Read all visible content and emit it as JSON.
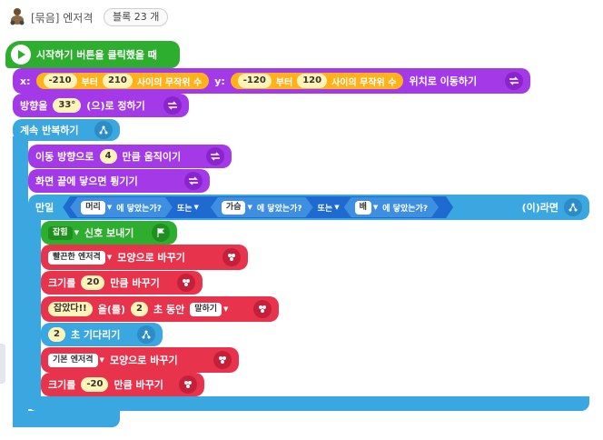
{
  "header": {
    "title": "[묶음] 엔저격",
    "count_label": "블록 23 개"
  },
  "blocks": {
    "start": {
      "label": "시작하기 버튼을 클릭했을 때"
    },
    "move": {
      "x_label": "x:",
      "x_from": "-210",
      "from_word": "부터",
      "x_to": "210",
      "random_label": "사이의 무작위 수",
      "y_label": "y:",
      "y_from": "-120",
      "y_to": "120",
      "tail": "위치로 이동하기"
    },
    "direction": {
      "label": "방향을",
      "value": "33°",
      "tail": "(으)로 정하기"
    },
    "forever": {
      "label": "계속 반복하기"
    },
    "step": {
      "label": "이동 방향으로",
      "value": "4",
      "tail": "만큼 움직이기"
    },
    "bounce": {
      "label": "화면 끝에 닿으면 튕기기"
    },
    "if": {
      "label": "만일",
      "c1_target": "머리",
      "c1_text": "에 닿았는가?",
      "or1": "또는",
      "c2_target": "가슴",
      "c2_text": "에 닿았는가?",
      "or2": "또는",
      "c3_target": "배",
      "c3_text": "에 닿았는가?",
      "tail": "(이)라면"
    },
    "signal": {
      "name": "잡힘",
      "tail": "신호 보내기"
    },
    "shape1": {
      "name": "빨끈한 엔저격",
      "tail": "모양으로 바꾸기"
    },
    "size1": {
      "label": "크기를",
      "value": "20",
      "tail": "만큼 바꾸기"
    },
    "say": {
      "text": "잡았다!!",
      "mid": "을(를)",
      "secs": "2",
      "secs_tail": "초 동안",
      "mode": "말하기"
    },
    "wait": {
      "secs": "2",
      "tail": "초 기다리기"
    },
    "shape2": {
      "name": "기본 엔저격",
      "tail": "모양으로 바꾸기"
    },
    "size2": {
      "label": "크기를",
      "value": "-20",
      "tail": "만큼 바꾸기"
    }
  },
  "colors": {
    "start": "#2eae2e",
    "motion": "#a339e7",
    "motion_dark": "#8a24cd",
    "flow": "#3aa7e0",
    "judge": "#1f6ad0",
    "judge_hex": "#3e8fe0",
    "calc": "#ffb21a",
    "calc_dark": "#f08c00",
    "start_dark": "#1f8f1f",
    "looks": "#e8334d",
    "looks_dark": "#c51f39",
    "flow_dark": "#2b8cc6"
  }
}
